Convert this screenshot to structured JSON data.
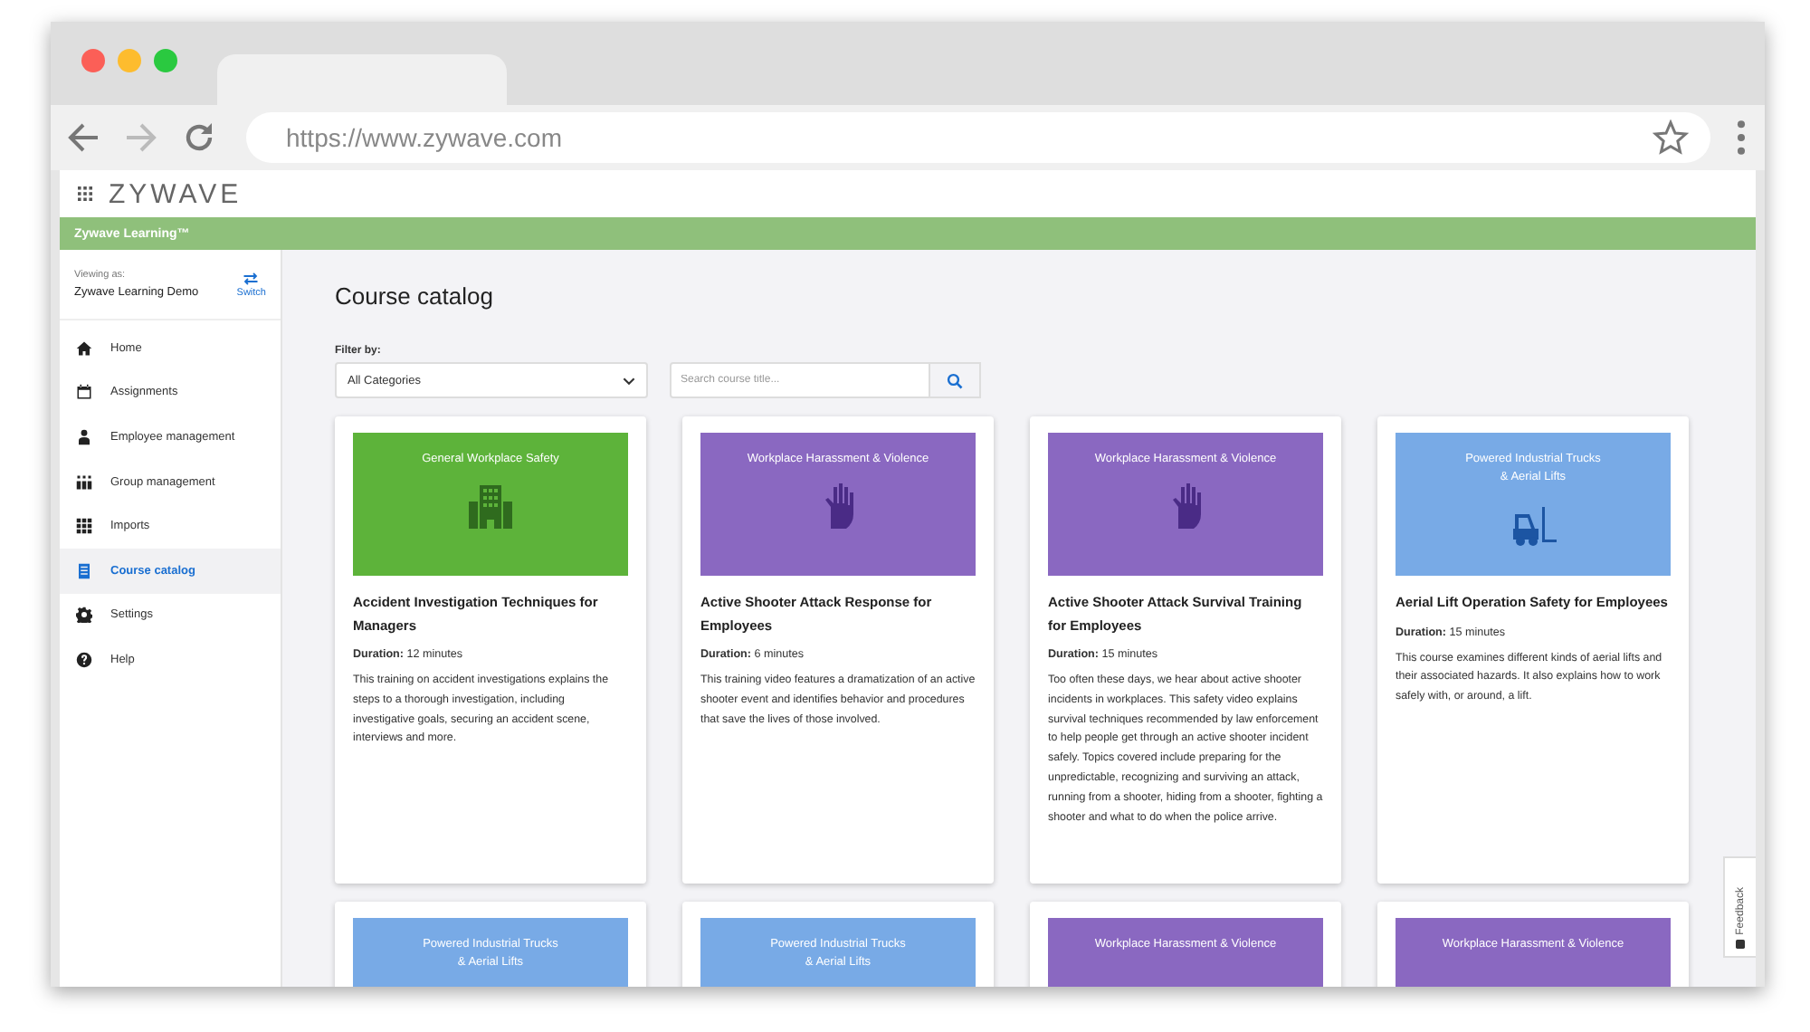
{
  "browser": {
    "url": "https://www.zywave.com"
  },
  "app": {
    "logo": "ZYWAVE",
    "product": "Zywave Learning™"
  },
  "viewing": {
    "label": "Viewing as:",
    "name": "Zywave Learning Demo",
    "switch": "Switch"
  },
  "sidebar": {
    "items": [
      {
        "label": "Home",
        "kind": "home",
        "selected": false
      },
      {
        "label": "Assignments",
        "kind": "calendar",
        "selected": false
      },
      {
        "label": "Employee management",
        "kind": "person",
        "selected": false
      },
      {
        "label": "Group management",
        "kind": "group",
        "selected": false
      },
      {
        "label": "Imports",
        "kind": "grid",
        "selected": false
      },
      {
        "label": "Course catalog",
        "kind": "document",
        "selected": true
      },
      {
        "label": "Settings",
        "kind": "gear",
        "selected": false
      },
      {
        "label": "Help",
        "kind": "help",
        "selected": false
      }
    ]
  },
  "page": {
    "title": "Course catalog",
    "filter_label": "Filter by:",
    "filter_value": "All Categories",
    "search": {
      "placeholder": "Search course title..."
    }
  },
  "courses": [
    {
      "category": "General Workplace Safety",
      "color": "#5db33a",
      "kind": "building",
      "title": "Accident Investigation Techniques for Managers",
      "duration_label": "Duration:",
      "duration": "12 minutes",
      "description": "This training on accident investigations explains the steps to a thorough investigation, including investigative goals, securing an accident scene, interviews and more."
    },
    {
      "category": "Workplace Harassment & Violence",
      "color": "#8a68c1",
      "kind": "hand",
      "title": "Active Shooter Attack Response for Employees",
      "duration_label": "Duration:",
      "duration": "6 minutes",
      "description": "This training video features a dramatization of an active shooter event and identifies behavior and procedures that save the lives of those involved."
    },
    {
      "category": "Workplace Harassment & Violence",
      "color": "#8a68c1",
      "kind": "hand",
      "title": "Active Shooter Attack Survival Training for Employees",
      "duration_label": "Duration:",
      "duration": "15 minutes",
      "description": "Too often these days, we hear about active shooter incidents in workplaces. This safety video explains survival techniques recommended by law enforcement to help people get through an active shooter incident safely. Topics covered include preparing for the unpredictable, recognizing and surviving an attack, running from a shooter, hiding from a shooter, fighting a shooter and what to do when the police arrive."
    },
    {
      "category": "Powered Industrial Trucks\n& Aerial Lifts",
      "color": "#78aae6",
      "kind": "forklift",
      "title": "Aerial Lift Operation Safety for Employees",
      "duration_label": "Duration:",
      "duration": "15 minutes",
      "description": "This course examines different kinds of aerial lifts and their associated hazards. It also explains how to work safely with, or around, a lift."
    },
    {
      "category": "Powered Industrial Trucks\n& Aerial Lifts",
      "color": "#78aae6"
    },
    {
      "category": "Powered Industrial Trucks\n& Aerial Lifts",
      "color": "#78aae6"
    },
    {
      "category": "Workplace Harassment & Violence",
      "color": "#8a68c1"
    },
    {
      "category": "Workplace Harassment & Violence",
      "color": "#8a68c1"
    }
  ],
  "feedback": {
    "label": "Feedback"
  }
}
